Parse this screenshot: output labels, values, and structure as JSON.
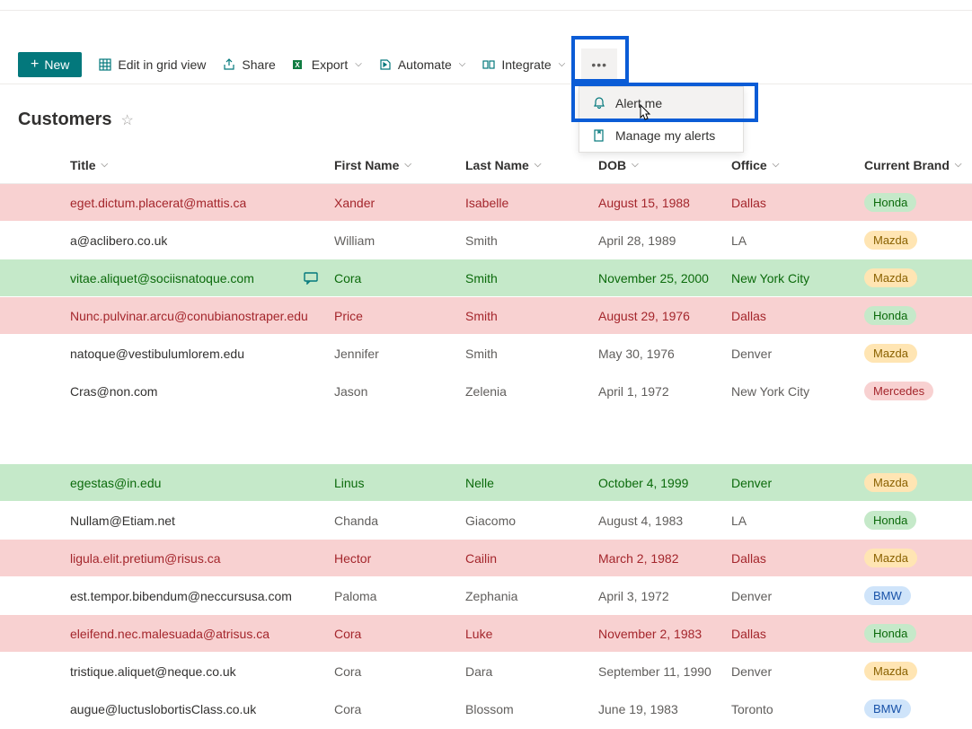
{
  "toolbar": {
    "new_label": "New",
    "edit_grid": "Edit in grid view",
    "share": "Share",
    "export": "Export",
    "automate": "Automate",
    "integrate": "Integrate"
  },
  "dropdown": {
    "alert_me": "Alert me",
    "manage_alerts": "Manage my alerts"
  },
  "page": {
    "title": "Customers"
  },
  "columns": {
    "title": "Title",
    "first_name": "First Name",
    "last_name": "Last Name",
    "dob": "DOB",
    "office": "Office",
    "brand": "Current Brand"
  },
  "rows": [
    {
      "title": "eget.dictum.placerat@mattis.ca",
      "first": "Xander",
      "last": "Isabelle",
      "dob": "August 15, 1988",
      "office": "Dallas",
      "brand": "Honda",
      "style": "pink",
      "pill": "honda"
    },
    {
      "title": "a@aclibero.co.uk",
      "first": "William",
      "last": "Smith",
      "dob": "April 28, 1989",
      "office": "LA",
      "brand": "Mazda",
      "style": "plain",
      "pill": "mazda"
    },
    {
      "title": "vitae.aliquet@sociisnatoque.com",
      "first": "Cora",
      "last": "Smith",
      "dob": "November 25, 2000",
      "office": "New York City",
      "brand": "Mazda",
      "style": "green",
      "pill": "mazda",
      "comment": true
    },
    {
      "title": "Nunc.pulvinar.arcu@conubianostraper.edu",
      "first": "Price",
      "last": "Smith",
      "dob": "August 29, 1976",
      "office": "Dallas",
      "brand": "Honda",
      "style": "pink",
      "pill": "honda"
    },
    {
      "title": "natoque@vestibulumlorem.edu",
      "first": "Jennifer",
      "last": "Smith",
      "dob": "May 30, 1976",
      "office": "Denver",
      "brand": "Mazda",
      "style": "plain",
      "pill": "mazda"
    },
    {
      "title": "Cras@non.com",
      "first": "Jason",
      "last": "Zelenia",
      "dob": "April 1, 1972",
      "office": "New York City",
      "brand": "Mercedes",
      "style": "plain",
      "pill": "mercedes"
    }
  ],
  "rows2": [
    {
      "title": "egestas@in.edu",
      "first": "Linus",
      "last": "Nelle",
      "dob": "October 4, 1999",
      "office": "Denver",
      "brand": "Mazda",
      "style": "green",
      "pill": "mazda"
    },
    {
      "title": "Nullam@Etiam.net",
      "first": "Chanda",
      "last": "Giacomo",
      "dob": "August 4, 1983",
      "office": "LA",
      "brand": "Honda",
      "style": "plain",
      "pill": "honda"
    },
    {
      "title": "ligula.elit.pretium@risus.ca",
      "first": "Hector",
      "last": "Cailin",
      "dob": "March 2, 1982",
      "office": "Dallas",
      "brand": "Mazda",
      "style": "pink",
      "pill": "mazda"
    },
    {
      "title": "est.tempor.bibendum@neccursusa.com",
      "first": "Paloma",
      "last": "Zephania",
      "dob": "April 3, 1972",
      "office": "Denver",
      "brand": "BMW",
      "style": "plain",
      "pill": "bmw"
    },
    {
      "title": "eleifend.nec.malesuada@atrisus.ca",
      "first": "Cora",
      "last": "Luke",
      "dob": "November 2, 1983",
      "office": "Dallas",
      "brand": "Honda",
      "style": "pink",
      "pill": "honda"
    },
    {
      "title": "tristique.aliquet@neque.co.uk",
      "first": "Cora",
      "last": "Dara",
      "dob": "September 11, 1990",
      "office": "Denver",
      "brand": "Mazda",
      "style": "plain",
      "pill": "mazda"
    },
    {
      "title": "augue@luctuslobortisClass.co.uk",
      "first": "Cora",
      "last": "Blossom",
      "dob": "June 19, 1983",
      "office": "Toronto",
      "brand": "BMW",
      "style": "plain",
      "pill": "bmw"
    }
  ]
}
